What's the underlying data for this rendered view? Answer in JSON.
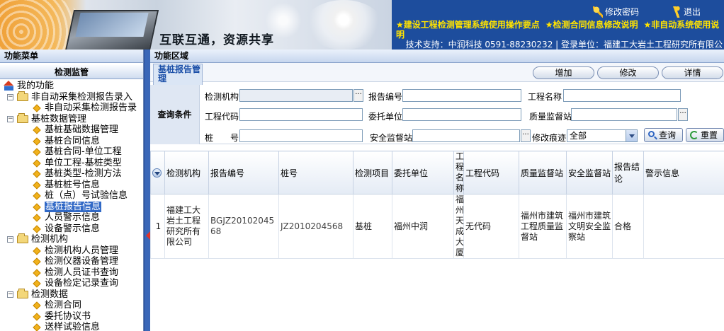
{
  "header": {
    "slogan": "互联互通，资源共享",
    "change_password": "修改密码",
    "logout": "退出",
    "notices": [
      "★建设工程检测管理系统使用操作要点",
      "★检测合同信息修改说明",
      "★非自动系统使用说明"
    ],
    "info_line": "技术支持：中润科技  0591-88230232 | 登录单位：福建工大岩土工程研究所有限公"
  },
  "left": {
    "title": "功能菜单",
    "subtitle": "检测监管",
    "tree": [
      {
        "label": "我的功能",
        "level": 0,
        "icon": "home-icon"
      },
      {
        "label": "非自动采集检测报告录入",
        "level": 1,
        "icon": "folder-icon",
        "expander": "⊟"
      },
      {
        "label": "非自动采集检测报告录",
        "level": 2,
        "icon": "diamond-icon"
      },
      {
        "label": "基桩数据管理",
        "level": 1,
        "icon": "folder-icon",
        "expander": "⊟"
      },
      {
        "label": "基桩基础数据管理",
        "level": 2,
        "icon": "diamond-icon"
      },
      {
        "label": "基桩合同信息",
        "level": 2,
        "icon": "diamond-icon"
      },
      {
        "label": "基桩合同-单位工程",
        "level": 2,
        "icon": "diamond-icon"
      },
      {
        "label": "单位工程-基桩类型",
        "level": 2,
        "icon": "diamond-icon"
      },
      {
        "label": "基桩类型-检测方法",
        "level": 2,
        "icon": "diamond-icon"
      },
      {
        "label": "基桩桩号信息",
        "level": 2,
        "icon": "diamond-icon"
      },
      {
        "label": "桩（点）号试验信息",
        "level": 2,
        "icon": "diamond-icon"
      },
      {
        "label": "基桩报告信息",
        "level": 2,
        "icon": "diamond-icon",
        "selected": true
      },
      {
        "label": "人员警示信息",
        "level": 2,
        "icon": "diamond-icon"
      },
      {
        "label": "设备警示信息",
        "level": 2,
        "icon": "diamond-icon"
      },
      {
        "label": "检测机构",
        "level": 1,
        "icon": "folder-icon",
        "expander": "⊟"
      },
      {
        "label": "检测机构人员管理",
        "level": 2,
        "icon": "diamond-icon"
      },
      {
        "label": "检测仪器设备管理",
        "level": 2,
        "icon": "diamond-icon"
      },
      {
        "label": "检测人员证书查询",
        "level": 2,
        "icon": "diamond-icon"
      },
      {
        "label": "设备检定记录查询",
        "level": 2,
        "icon": "diamond-icon"
      },
      {
        "label": "检测数据",
        "level": 1,
        "icon": "folder-icon",
        "expander": "⊟"
      },
      {
        "label": "检测合同",
        "level": 2,
        "icon": "diamond-icon"
      },
      {
        "label": "委托协议书",
        "level": 2,
        "icon": "diamond-icon"
      },
      {
        "label": "送样试验信息",
        "level": 2,
        "icon": "diamond-icon"
      }
    ]
  },
  "right": {
    "title": "功能区域",
    "page_tab": "基桩报告管理",
    "buttons": {
      "add": "增加",
      "edit": "修改",
      "detail": "详情"
    },
    "query": {
      "label": "查询条件",
      "fields": {
        "org": {
          "label": "检测机构",
          "value": ""
        },
        "report_no": {
          "label": "报告编号",
          "value": ""
        },
        "project_name": {
          "label": "工程名称",
          "value": ""
        },
        "project_code": {
          "label": "工程代码",
          "value": ""
        },
        "client": {
          "label": "委托单位",
          "value": ""
        },
        "quality_station": {
          "label": "质量监督站",
          "value": ""
        },
        "pile_no": {
          "label": "桩　　号",
          "value": ""
        },
        "safety_station": {
          "label": "安全监督站",
          "value": ""
        },
        "modify_trace": {
          "label": "修改痕迹",
          "value": "全部"
        }
      },
      "search_button": "查询",
      "reset_button": "重置"
    },
    "grid": {
      "columns": [
        "检测机构",
        "报告编号",
        "桩号",
        "检测项目",
        "委托单位",
        "工程名称",
        "工程代码",
        "质量监督站",
        "安全监督站",
        "报告结论",
        "警示信息"
      ],
      "rows": [
        {
          "index": "1",
          "org": "福建工大岩土工程研究所有限公司",
          "report_no": "BGJZ2010204568",
          "pile_no": "JZ2010204568",
          "item": "基桩",
          "client": "福州中润",
          "project_name": "福州天成大厦",
          "project_code": "无代码",
          "quality_station": "福州市建筑工程质量监督站",
          "safety_station": "福州市建筑文明安全监察站",
          "conclusion": "合格",
          "warning": ""
        }
      ]
    }
  },
  "colors": {
    "top_bar": "#1d4d9d",
    "notice_yellow": "#ffe300",
    "selection": "#3169c6",
    "splitter": "#3a67b8"
  }
}
